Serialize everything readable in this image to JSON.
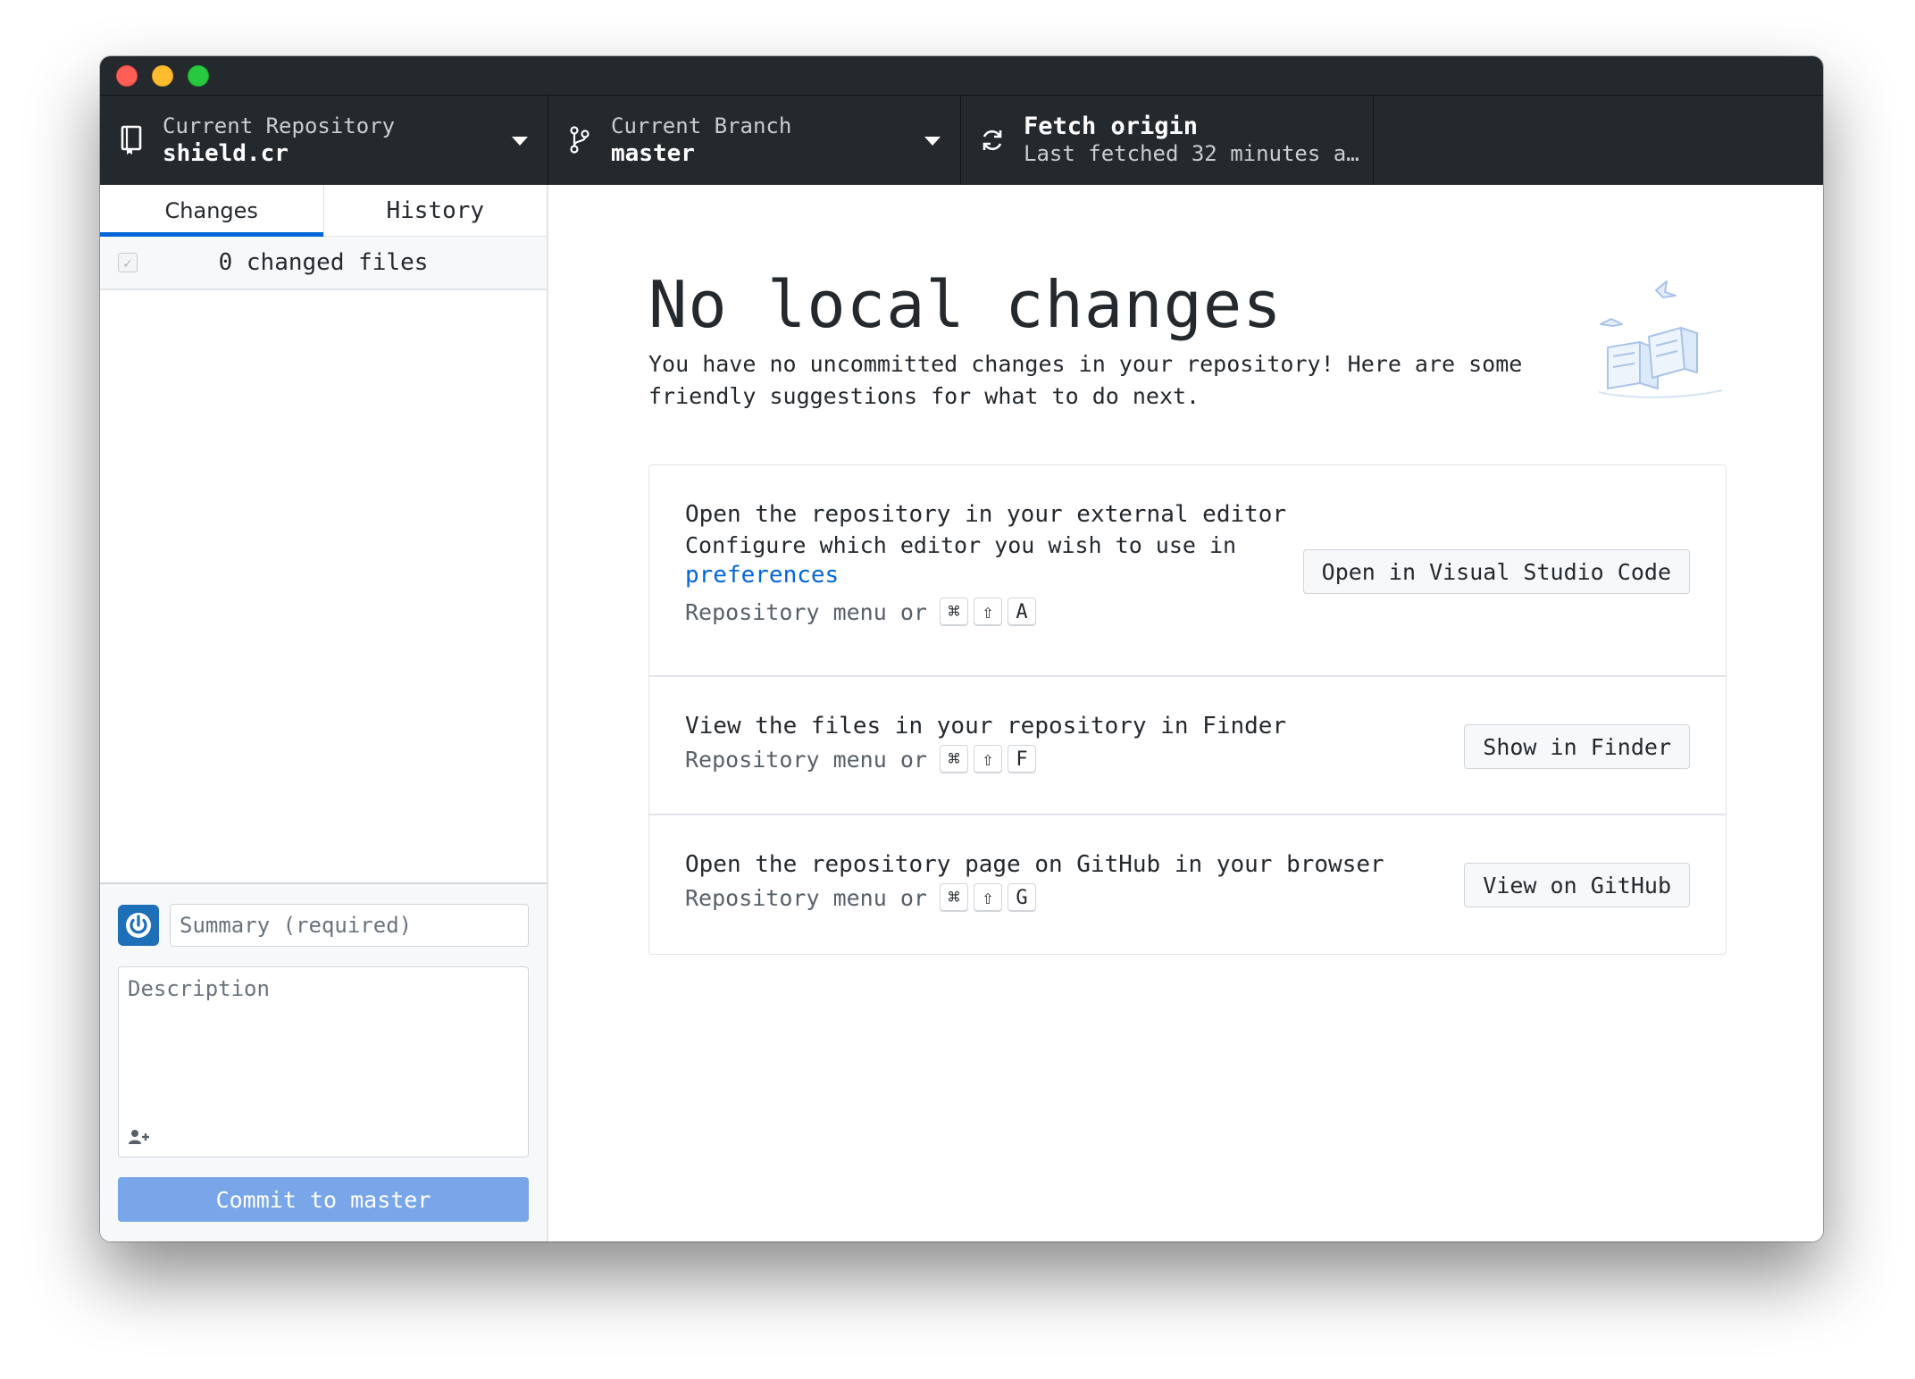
{
  "toolbar": {
    "repository": {
      "label": "Current Repository",
      "value": "shield.cr",
      "icon": "repo-icon"
    },
    "branch": {
      "label": "Current Branch",
      "value": "master",
      "icon": "git-branch-icon"
    },
    "fetch": {
      "title": "Fetch origin",
      "subtitle": "Last fetched 32 minutes a…",
      "icon": "sync-icon"
    }
  },
  "sidebar": {
    "tabs": [
      {
        "label": "Changes",
        "active": true
      },
      {
        "label": "History",
        "active": false
      }
    ],
    "changed_files_label": "0 changed files",
    "commit": {
      "summary_placeholder": "Summary (required)",
      "description_placeholder": "Description",
      "button_label": "Commit to master"
    }
  },
  "content": {
    "title": "No local changes",
    "description": "You have no uncommitted changes in your repository! Here are some friendly suggestions for what to do next.",
    "actions": [
      {
        "title": "Open the repository in your external editor",
        "description": "Configure which editor you wish to use in",
        "link": "preferences",
        "shortcut_text": "Repository menu or",
        "keys": [
          "⌘",
          "⇧",
          "A"
        ],
        "button": "Open in Visual Studio Code"
      },
      {
        "title": "View the files in your repository in Finder",
        "shortcut_text": "Repository menu or",
        "keys": [
          "⌘",
          "⇧",
          "F"
        ],
        "button": "Show in Finder"
      },
      {
        "title": "Open the repository page on GitHub in your browser",
        "shortcut_text": "Repository menu or",
        "keys": [
          "⌘",
          "⇧",
          "G"
        ],
        "button": "View on GitHub"
      }
    ]
  },
  "colors": {
    "toolbar_bg": "#24292e",
    "accent": "#0366d6",
    "commit_button": "#79a6e8"
  }
}
